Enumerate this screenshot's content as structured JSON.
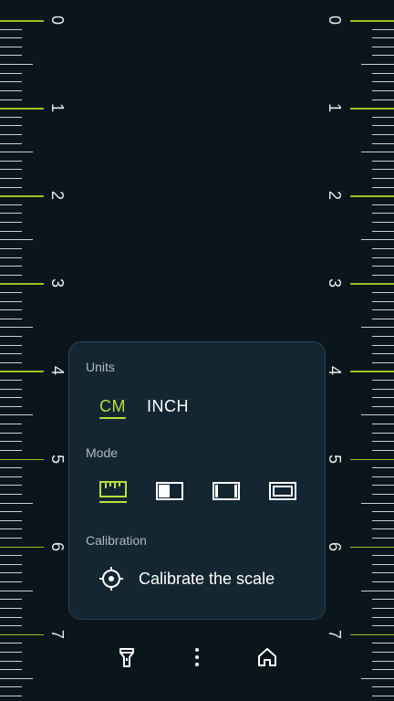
{
  "ruler": {
    "numbers": [
      "0",
      "1",
      "2",
      "3",
      "4",
      "5",
      "6",
      "7"
    ],
    "accent_color": "#9bbf23"
  },
  "panel": {
    "units": {
      "label": "Units",
      "options": [
        "CM",
        "INCH"
      ],
      "selected": "CM"
    },
    "mode": {
      "label": "Mode",
      "options": [
        "ruler-icon",
        "left-half-icon",
        "center-icon",
        "full-frame-icon"
      ],
      "selected": "ruler-icon"
    },
    "calibration": {
      "label": "Calibration",
      "action_label": "Calibrate the scale",
      "icon": "crosshair-icon"
    }
  },
  "bottom_bar": {
    "icons": [
      "flashlight-icon",
      "more-vertical-icon",
      "home-icon"
    ]
  },
  "colors": {
    "background": "#0b151c",
    "panel": "#142632",
    "accent": "#b8e03a"
  }
}
